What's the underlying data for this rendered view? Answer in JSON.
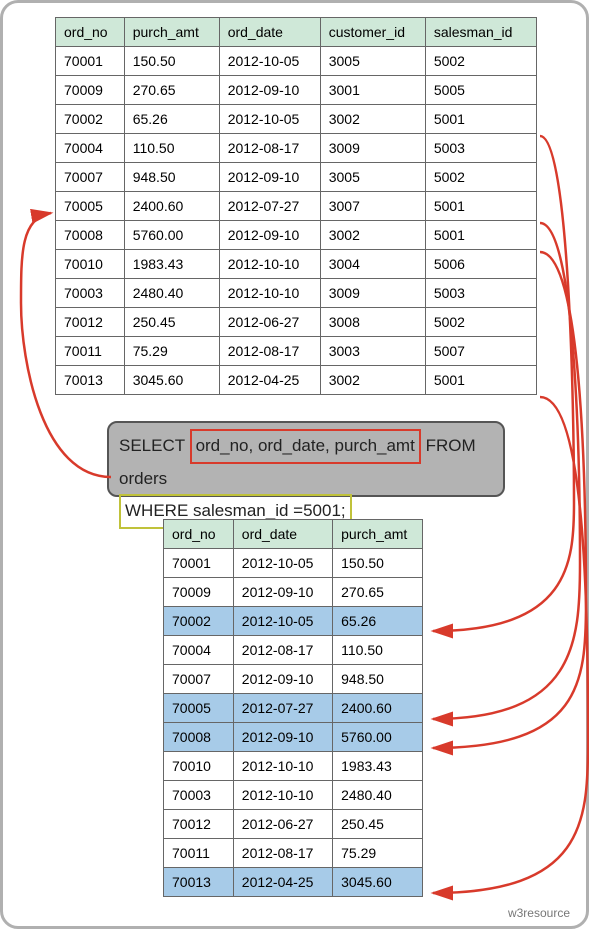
{
  "top_table": {
    "headers": [
      "ord_no",
      "purch_amt",
      "ord_date",
      "customer_id",
      "salesman_id"
    ],
    "rows": [
      [
        "70001",
        "150.50",
        "2012-10-05",
        "3005",
        "5002"
      ],
      [
        "70009",
        "270.65",
        "2012-09-10",
        "3001",
        "5005"
      ],
      [
        "70002",
        "65.26",
        "2012-10-05",
        "3002",
        "5001"
      ],
      [
        "70004",
        "110.50",
        "2012-08-17",
        "3009",
        "5003"
      ],
      [
        "70007",
        "948.50",
        "2012-09-10",
        "3005",
        "5002"
      ],
      [
        "70005",
        "2400.60",
        "2012-07-27",
        "3007",
        "5001"
      ],
      [
        "70008",
        "5760.00",
        "2012-09-10",
        "3002",
        "5001"
      ],
      [
        "70010",
        "1983.43",
        "2012-10-10",
        "3004",
        "5006"
      ],
      [
        "70003",
        "2480.40",
        "2012-10-10",
        "3009",
        "5003"
      ],
      [
        "70012",
        "250.45",
        "2012-06-27",
        "3008",
        "5002"
      ],
      [
        "70011",
        "75.29",
        "2012-08-17",
        "3003",
        "5007"
      ],
      [
        "70013",
        "3045.60",
        "2012-04-25",
        "3002",
        "5001"
      ]
    ]
  },
  "query": {
    "kw_select": "SELECT",
    "cols": "ord_no, ord_date, purch_amt",
    "kw_from": "FROM",
    "table": "orders",
    "where": "WHERE salesman_id =5001;"
  },
  "bot_table": {
    "headers": [
      "ord_no",
      "ord_date",
      "purch_amt"
    ],
    "rows": [
      {
        "cells": [
          "70001",
          "2012-10-05",
          "150.50"
        ],
        "hl": false
      },
      {
        "cells": [
          "70009",
          "2012-09-10",
          "270.65"
        ],
        "hl": false
      },
      {
        "cells": [
          "70002",
          "2012-10-05",
          "65.26"
        ],
        "hl": true
      },
      {
        "cells": [
          "70004",
          "2012-08-17",
          "110.50"
        ],
        "hl": false
      },
      {
        "cells": [
          "70007",
          "2012-09-10",
          "948.50"
        ],
        "hl": false
      },
      {
        "cells": [
          "70005",
          "2012-07-27",
          "2400.60"
        ],
        "hl": true
      },
      {
        "cells": [
          "70008",
          "2012-09-10",
          "5760.00"
        ],
        "hl": true
      },
      {
        "cells": [
          "70010",
          "2012-10-10",
          "1983.43"
        ],
        "hl": false
      },
      {
        "cells": [
          "70003",
          "2012-10-10",
          "2480.40"
        ],
        "hl": false
      },
      {
        "cells": [
          "70012",
          "2012-06-27",
          "250.45"
        ],
        "hl": false
      },
      {
        "cells": [
          "70011",
          "2012-08-17",
          "75.29"
        ],
        "hl": false
      },
      {
        "cells": [
          "70013",
          "2012-04-25",
          "3045.60"
        ],
        "hl": true
      }
    ]
  },
  "footer": "w3resource",
  "chart_data": {
    "type": "table",
    "description": "SQL SELECT with WHERE filter illustration",
    "source_table": {
      "name": "orders",
      "columns": [
        "ord_no",
        "purch_amt",
        "ord_date",
        "customer_id",
        "salesman_id"
      ],
      "rows": [
        [
          70001,
          150.5,
          "2012-10-05",
          3005,
          5002
        ],
        [
          70009,
          270.65,
          "2012-09-10",
          3001,
          5005
        ],
        [
          70002,
          65.26,
          "2012-10-05",
          3002,
          5001
        ],
        [
          70004,
          110.5,
          "2012-08-17",
          3009,
          5003
        ],
        [
          70007,
          948.5,
          "2012-09-10",
          3005,
          5002
        ],
        [
          70005,
          2400.6,
          "2012-07-27",
          3007,
          5001
        ],
        [
          70008,
          5760.0,
          "2012-09-10",
          3002,
          5001
        ],
        [
          70010,
          1983.43,
          "2012-10-10",
          3004,
          5006
        ],
        [
          70003,
          2480.4,
          "2012-10-10",
          3009,
          5003
        ],
        [
          70012,
          250.45,
          "2012-06-27",
          3008,
          5002
        ],
        [
          70011,
          75.29,
          "2012-08-17",
          3003,
          5007
        ],
        [
          70013,
          3045.6,
          "2012-04-25",
          3002,
          5001
        ]
      ]
    },
    "sql": "SELECT ord_no, ord_date, purch_amt FROM orders WHERE salesman_id =5001;",
    "result_table": {
      "columns": [
        "ord_no",
        "ord_date",
        "purch_amt"
      ],
      "rows": [
        [
          70001,
          "2012-10-05",
          150.5
        ],
        [
          70009,
          "2012-09-10",
          270.65
        ],
        [
          70002,
          "2012-10-05",
          65.26
        ],
        [
          70004,
          "2012-08-17",
          110.5
        ],
        [
          70007,
          "2012-09-10",
          948.5
        ],
        [
          70005,
          "2012-07-27",
          2400.6
        ],
        [
          70008,
          "2012-09-10",
          5760.0
        ],
        [
          70010,
          "2012-10-10",
          1983.43
        ],
        [
          70003,
          "2012-10-10",
          2480.4
        ],
        [
          70012,
          "2012-06-27",
          250.45
        ],
        [
          70011,
          "2012-08-17",
          75.29
        ],
        [
          70013,
          "2012-04-25",
          3045.6
        ]
      ],
      "highlighted_rows_where_salesman_5001": [
        2,
        5,
        6,
        11
      ]
    },
    "arrows": [
      {
        "from": "query-box-where",
        "to": "source-row-70005"
      },
      {
        "from": "source-row-70002",
        "to": "result-row-70002"
      },
      {
        "from": "source-row-70005",
        "to": "result-row-70005"
      },
      {
        "from": "source-row-70008",
        "to": "result-row-70008"
      },
      {
        "from": "source-row-70013",
        "to": "result-row-70013"
      }
    ]
  }
}
